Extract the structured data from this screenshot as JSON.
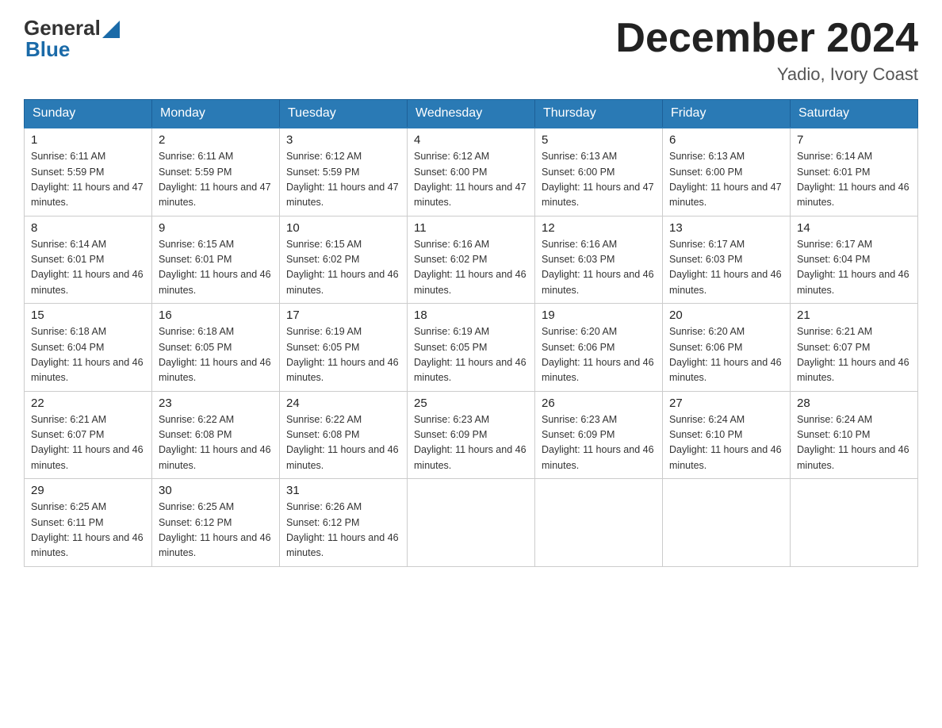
{
  "header": {
    "logo": {
      "text_general": "General",
      "arrow": "▶",
      "text_blue": "Blue"
    },
    "title": "December 2024",
    "subtitle": "Yadio, Ivory Coast"
  },
  "weekdays": [
    "Sunday",
    "Monday",
    "Tuesday",
    "Wednesday",
    "Thursday",
    "Friday",
    "Saturday"
  ],
  "weeks": [
    [
      {
        "day": "1",
        "sunrise": "6:11 AM",
        "sunset": "5:59 PM",
        "daylight": "11 hours and 47 minutes."
      },
      {
        "day": "2",
        "sunrise": "6:11 AM",
        "sunset": "5:59 PM",
        "daylight": "11 hours and 47 minutes."
      },
      {
        "day": "3",
        "sunrise": "6:12 AM",
        "sunset": "5:59 PM",
        "daylight": "11 hours and 47 minutes."
      },
      {
        "day": "4",
        "sunrise": "6:12 AM",
        "sunset": "6:00 PM",
        "daylight": "11 hours and 47 minutes."
      },
      {
        "day": "5",
        "sunrise": "6:13 AM",
        "sunset": "6:00 PM",
        "daylight": "11 hours and 47 minutes."
      },
      {
        "day": "6",
        "sunrise": "6:13 AM",
        "sunset": "6:00 PM",
        "daylight": "11 hours and 47 minutes."
      },
      {
        "day": "7",
        "sunrise": "6:14 AM",
        "sunset": "6:01 PM",
        "daylight": "11 hours and 46 minutes."
      }
    ],
    [
      {
        "day": "8",
        "sunrise": "6:14 AM",
        "sunset": "6:01 PM",
        "daylight": "11 hours and 46 minutes."
      },
      {
        "day": "9",
        "sunrise": "6:15 AM",
        "sunset": "6:01 PM",
        "daylight": "11 hours and 46 minutes."
      },
      {
        "day": "10",
        "sunrise": "6:15 AM",
        "sunset": "6:02 PM",
        "daylight": "11 hours and 46 minutes."
      },
      {
        "day": "11",
        "sunrise": "6:16 AM",
        "sunset": "6:02 PM",
        "daylight": "11 hours and 46 minutes."
      },
      {
        "day": "12",
        "sunrise": "6:16 AM",
        "sunset": "6:03 PM",
        "daylight": "11 hours and 46 minutes."
      },
      {
        "day": "13",
        "sunrise": "6:17 AM",
        "sunset": "6:03 PM",
        "daylight": "11 hours and 46 minutes."
      },
      {
        "day": "14",
        "sunrise": "6:17 AM",
        "sunset": "6:04 PM",
        "daylight": "11 hours and 46 minutes."
      }
    ],
    [
      {
        "day": "15",
        "sunrise": "6:18 AM",
        "sunset": "6:04 PM",
        "daylight": "11 hours and 46 minutes."
      },
      {
        "day": "16",
        "sunrise": "6:18 AM",
        "sunset": "6:05 PM",
        "daylight": "11 hours and 46 minutes."
      },
      {
        "day": "17",
        "sunrise": "6:19 AM",
        "sunset": "6:05 PM",
        "daylight": "11 hours and 46 minutes."
      },
      {
        "day": "18",
        "sunrise": "6:19 AM",
        "sunset": "6:05 PM",
        "daylight": "11 hours and 46 minutes."
      },
      {
        "day": "19",
        "sunrise": "6:20 AM",
        "sunset": "6:06 PM",
        "daylight": "11 hours and 46 minutes."
      },
      {
        "day": "20",
        "sunrise": "6:20 AM",
        "sunset": "6:06 PM",
        "daylight": "11 hours and 46 minutes."
      },
      {
        "day": "21",
        "sunrise": "6:21 AM",
        "sunset": "6:07 PM",
        "daylight": "11 hours and 46 minutes."
      }
    ],
    [
      {
        "day": "22",
        "sunrise": "6:21 AM",
        "sunset": "6:07 PM",
        "daylight": "11 hours and 46 minutes."
      },
      {
        "day": "23",
        "sunrise": "6:22 AM",
        "sunset": "6:08 PM",
        "daylight": "11 hours and 46 minutes."
      },
      {
        "day": "24",
        "sunrise": "6:22 AM",
        "sunset": "6:08 PM",
        "daylight": "11 hours and 46 minutes."
      },
      {
        "day": "25",
        "sunrise": "6:23 AM",
        "sunset": "6:09 PM",
        "daylight": "11 hours and 46 minutes."
      },
      {
        "day": "26",
        "sunrise": "6:23 AM",
        "sunset": "6:09 PM",
        "daylight": "11 hours and 46 minutes."
      },
      {
        "day": "27",
        "sunrise": "6:24 AM",
        "sunset": "6:10 PM",
        "daylight": "11 hours and 46 minutes."
      },
      {
        "day": "28",
        "sunrise": "6:24 AM",
        "sunset": "6:10 PM",
        "daylight": "11 hours and 46 minutes."
      }
    ],
    [
      {
        "day": "29",
        "sunrise": "6:25 AM",
        "sunset": "6:11 PM",
        "daylight": "11 hours and 46 minutes."
      },
      {
        "day": "30",
        "sunrise": "6:25 AM",
        "sunset": "6:12 PM",
        "daylight": "11 hours and 46 minutes."
      },
      {
        "day": "31",
        "sunrise": "6:26 AM",
        "sunset": "6:12 PM",
        "daylight": "11 hours and 46 minutes."
      },
      null,
      null,
      null,
      null
    ]
  ]
}
